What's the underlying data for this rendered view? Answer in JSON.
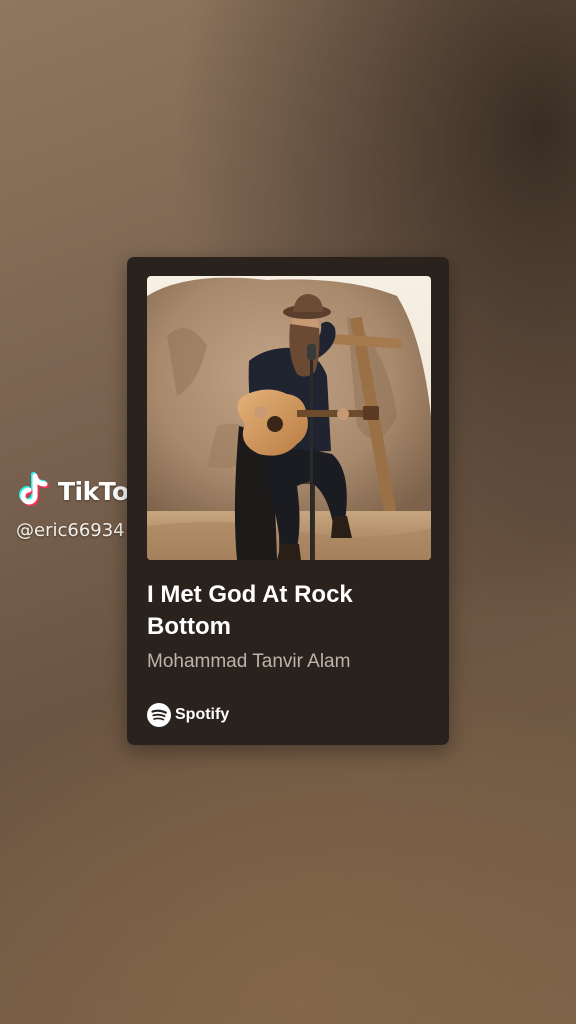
{
  "watermark": {
    "brand": "TikTok",
    "handle": "@eric66934",
    "icon": "tiktok-logo-icon"
  },
  "card": {
    "title": "I Met God At Rock Bottom",
    "artist": "Mohammad Tanvir Alam",
    "service": "Spotify",
    "service_icon": "spotify-logo-icon",
    "art_description_icon": "album-art-image"
  }
}
